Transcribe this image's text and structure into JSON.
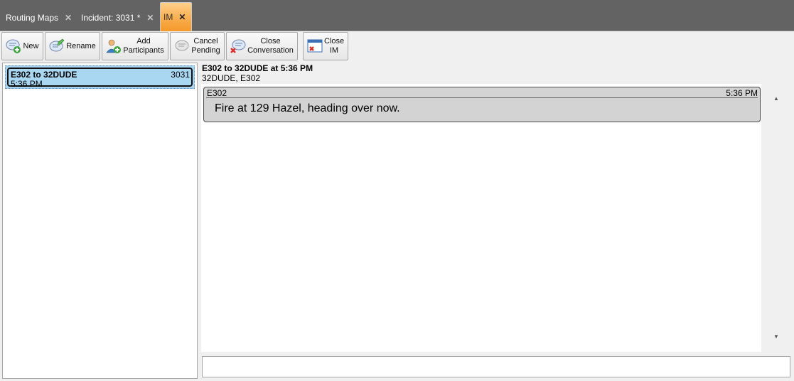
{
  "tabs": [
    {
      "label": "Routing Maps",
      "closable": true
    },
    {
      "label": "Incident: 3031 *",
      "closable": true
    },
    {
      "label": "IM",
      "closable": true,
      "active": true
    }
  ],
  "toolbar": {
    "new": "New",
    "rename": "Rename",
    "add_participants": "Add Participants",
    "cancel_pending": "Cancel Pending",
    "close_conversation": "Close Conversation",
    "close_im": "Close IM"
  },
  "conversations": [
    {
      "title": "E302 to 32DUDE",
      "incident": "3031",
      "time": "5:36 PM",
      "selected": true
    }
  ],
  "conversation": {
    "title": "E302 to 32DUDE at 5:36 PM",
    "participants": "32DUDE, E302",
    "messages": [
      {
        "sender": "E302",
        "time": "5:36 PM",
        "text": "Fire at 129 Hazel, heading over now."
      }
    ]
  },
  "compose": {
    "value": "",
    "placeholder": ""
  },
  "colors": {
    "tabstrip": "#636363",
    "active_tab": "#f7a640",
    "selected_item": "#a7d3ef",
    "message_bubble": "#d3d3d3"
  }
}
